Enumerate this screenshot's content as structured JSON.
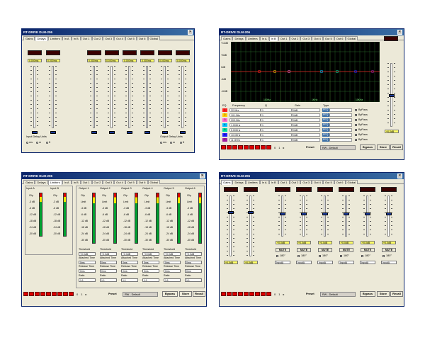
{
  "app_title": "RT-DRIVE DLM-206",
  "tabs": [
    "Gains",
    "Delays",
    "Limiters",
    "In A",
    "In B",
    "Out 1",
    "Out 2",
    "Out 3",
    "Out 4",
    "Out 5",
    "Out 6",
    "Global"
  ],
  "delays": {
    "input_values": [
      "0.000ms",
      "0.000ms"
    ],
    "output_values": [
      "0.000ms",
      "0.000ms",
      "0.000ms",
      "0.000ms",
      "0.000ms",
      "0.000ms"
    ],
    "input_units_label": "Input Delay Units",
    "output_units_label": "Output Delay Units",
    "units": [
      "ms",
      "m",
      "ft"
    ],
    "selected_unit": "ms"
  },
  "eq": {
    "db_labels": [
      "+12dB",
      "+6dB",
      "0dB",
      "-6dB",
      "-12dB"
    ],
    "freq_labels": [
      "100Hz",
      "1KHz",
      "10KHz"
    ],
    "headers": [
      "EQ",
      "Frequency",
      "Q",
      "Gain",
      "Type"
    ],
    "rows": [
      {
        "num": "1",
        "freq": "32.0Hz",
        "q": "1",
        "gain": "0dB",
        "type": "PEQ",
        "bypass": "ByPass",
        "color": "#ff2020"
      },
      {
        "num": "2",
        "freq": "101.0Hz",
        "q": "1",
        "gain": "0dB",
        "type": "PEQ",
        "bypass": "ByPass",
        "color": "#ffcc00"
      },
      {
        "num": "3",
        "freq": "203.0Hz",
        "q": "1",
        "gain": "0dB",
        "type": "PEQ",
        "bypass": "ByPass",
        "color": "#ff66cc"
      },
      {
        "num": "4",
        "freq": "1.00KHz",
        "q": "1",
        "gain": "0dB",
        "type": "PEQ",
        "bypass": "ByPass",
        "color": "#00c0ff"
      },
      {
        "num": "5",
        "freq": "5.00KHz",
        "q": "1",
        "gain": "0dB",
        "type": "PEQ",
        "bypass": "ByPass",
        "color": "#00e0a0"
      },
      {
        "num": "6",
        "freq": "10.0KHz",
        "q": "1",
        "gain": "0dB",
        "type": "PEQ",
        "bypass": "ByPass",
        "color": "#2020ff"
      },
      {
        "num": "7",
        "freq": "11.0KHz",
        "q": "1",
        "gain": "0dB",
        "type": "PEQ",
        "bypass": "ByPass",
        "color": "#a020a0"
      }
    ],
    "gain_value": "+0.0dB"
  },
  "limiters": {
    "inputs": [
      "Input A",
      "Input B"
    ],
    "outputs": [
      "Output 1",
      "Output 2",
      "Output 3",
      "Output 4",
      "Output 5",
      "Output 6"
    ],
    "meter_scale": [
      "Clip",
      "-3 dB",
      "-6 dB",
      "-12 dB",
      "-18 dB",
      "-24 dB",
      "-30 dB"
    ],
    "out_scale": [
      "Clip",
      "Limit",
      "-3 dB",
      "-6 dB",
      "-12 dB",
      "-18 dB",
      "-24 dB",
      "-30 dB"
    ],
    "threshold_label": "Threshold",
    "threshold_value": "+0.0dB",
    "attack_label": "Attached Time",
    "attack_value": "0ms",
    "release_label": "Release Time",
    "release_value": "0ms",
    "ratio_label": "Ratio",
    "ratio_value": "1:1"
  },
  "gains": {
    "input_values": [
      "+0.0dB",
      "+0.0dB"
    ],
    "output_values": [
      "+0.0dB",
      "+0.0dB",
      "+0.0dB",
      "+0.0dB",
      "+0.0dB",
      "+0.0dB"
    ],
    "mute_label": "MUTE",
    "phase_label": "180°",
    "source_value": "InputA"
  },
  "footer": {
    "counter": "0",
    "counter2": "1",
    "preset_label": "Preset",
    "preset_value": "RW - Default",
    "bypass": "Bypass",
    "store": "Store",
    "recall": "Recall"
  }
}
